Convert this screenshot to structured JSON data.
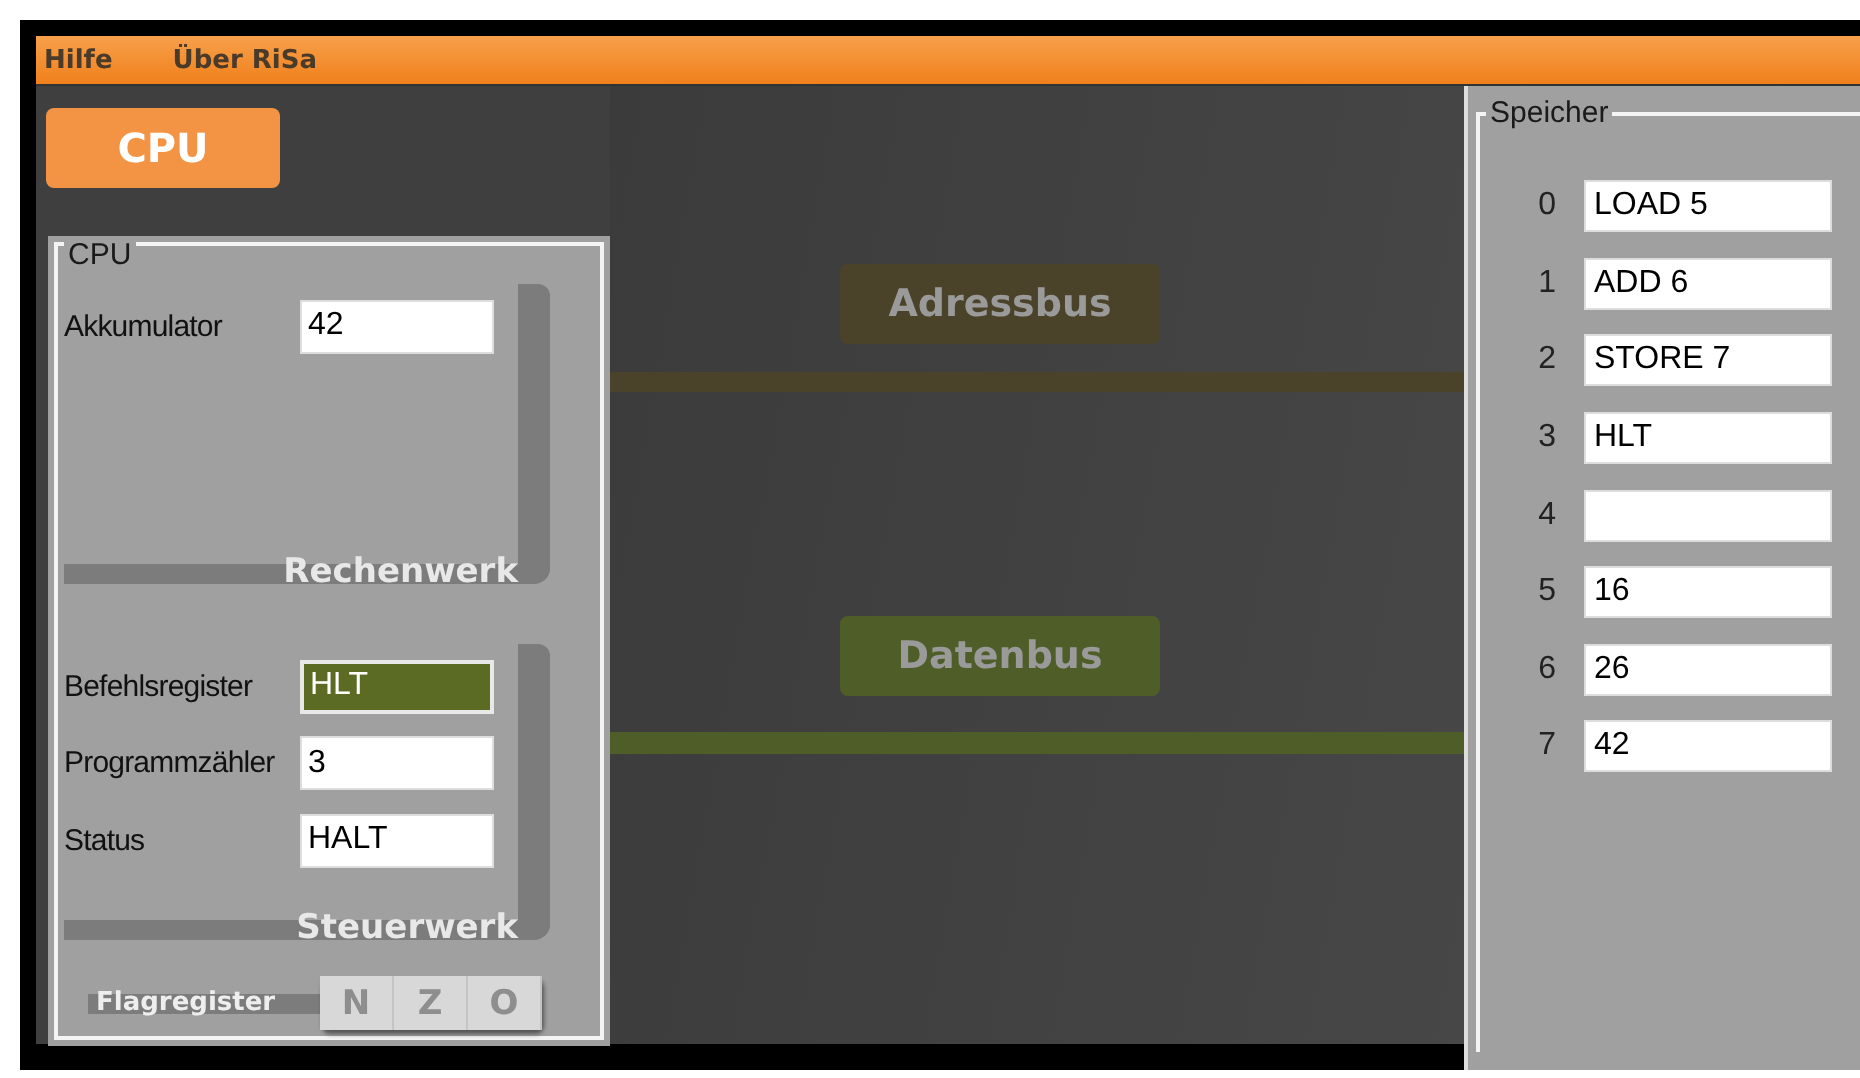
{
  "menu": [
    {
      "label": "Hilfe"
    },
    {
      "label": "Über RiSa"
    }
  ],
  "cpu_button": {
    "label": "CPU"
  },
  "cpu": {
    "title": "CPU",
    "rechenwerk": {
      "title": "Rechenwerk",
      "registers": [
        {
          "label": "Akkumulator",
          "value": "42",
          "highlighted": false
        }
      ]
    },
    "steuerwerk": {
      "title": "Steuerwerk",
      "registers": [
        {
          "label": "Befehlsregister",
          "value": "HLT",
          "highlighted": true
        },
        {
          "label": "Programmzähler",
          "value": "3",
          "highlighted": false
        },
        {
          "label": "Status",
          "value": "HALT",
          "highlighted": false
        }
      ]
    },
    "flagregister": {
      "label": "Flagregister",
      "flags": [
        {
          "label": "N",
          "set": false
        },
        {
          "label": "Z",
          "set": false
        },
        {
          "label": "O",
          "set": false
        }
      ]
    }
  },
  "buses": [
    {
      "label": "Adressbus",
      "color": "#4a4229"
    },
    {
      "label": "Datenbus",
      "color": "#4f5e28"
    }
  ],
  "memory": {
    "title": "Speicher",
    "cells": [
      {
        "address": "0",
        "value": "LOAD 5"
      },
      {
        "address": "1",
        "value": "ADD 6"
      },
      {
        "address": "2",
        "value": "STORE 7"
      },
      {
        "address": "3",
        "value": "HLT"
      },
      {
        "address": "4"
      },
      {
        "address": "5",
        "value": "16"
      },
      {
        "address": "6",
        "value": "26"
      },
      {
        "address": "7",
        "value": "42"
      }
    ]
  }
}
